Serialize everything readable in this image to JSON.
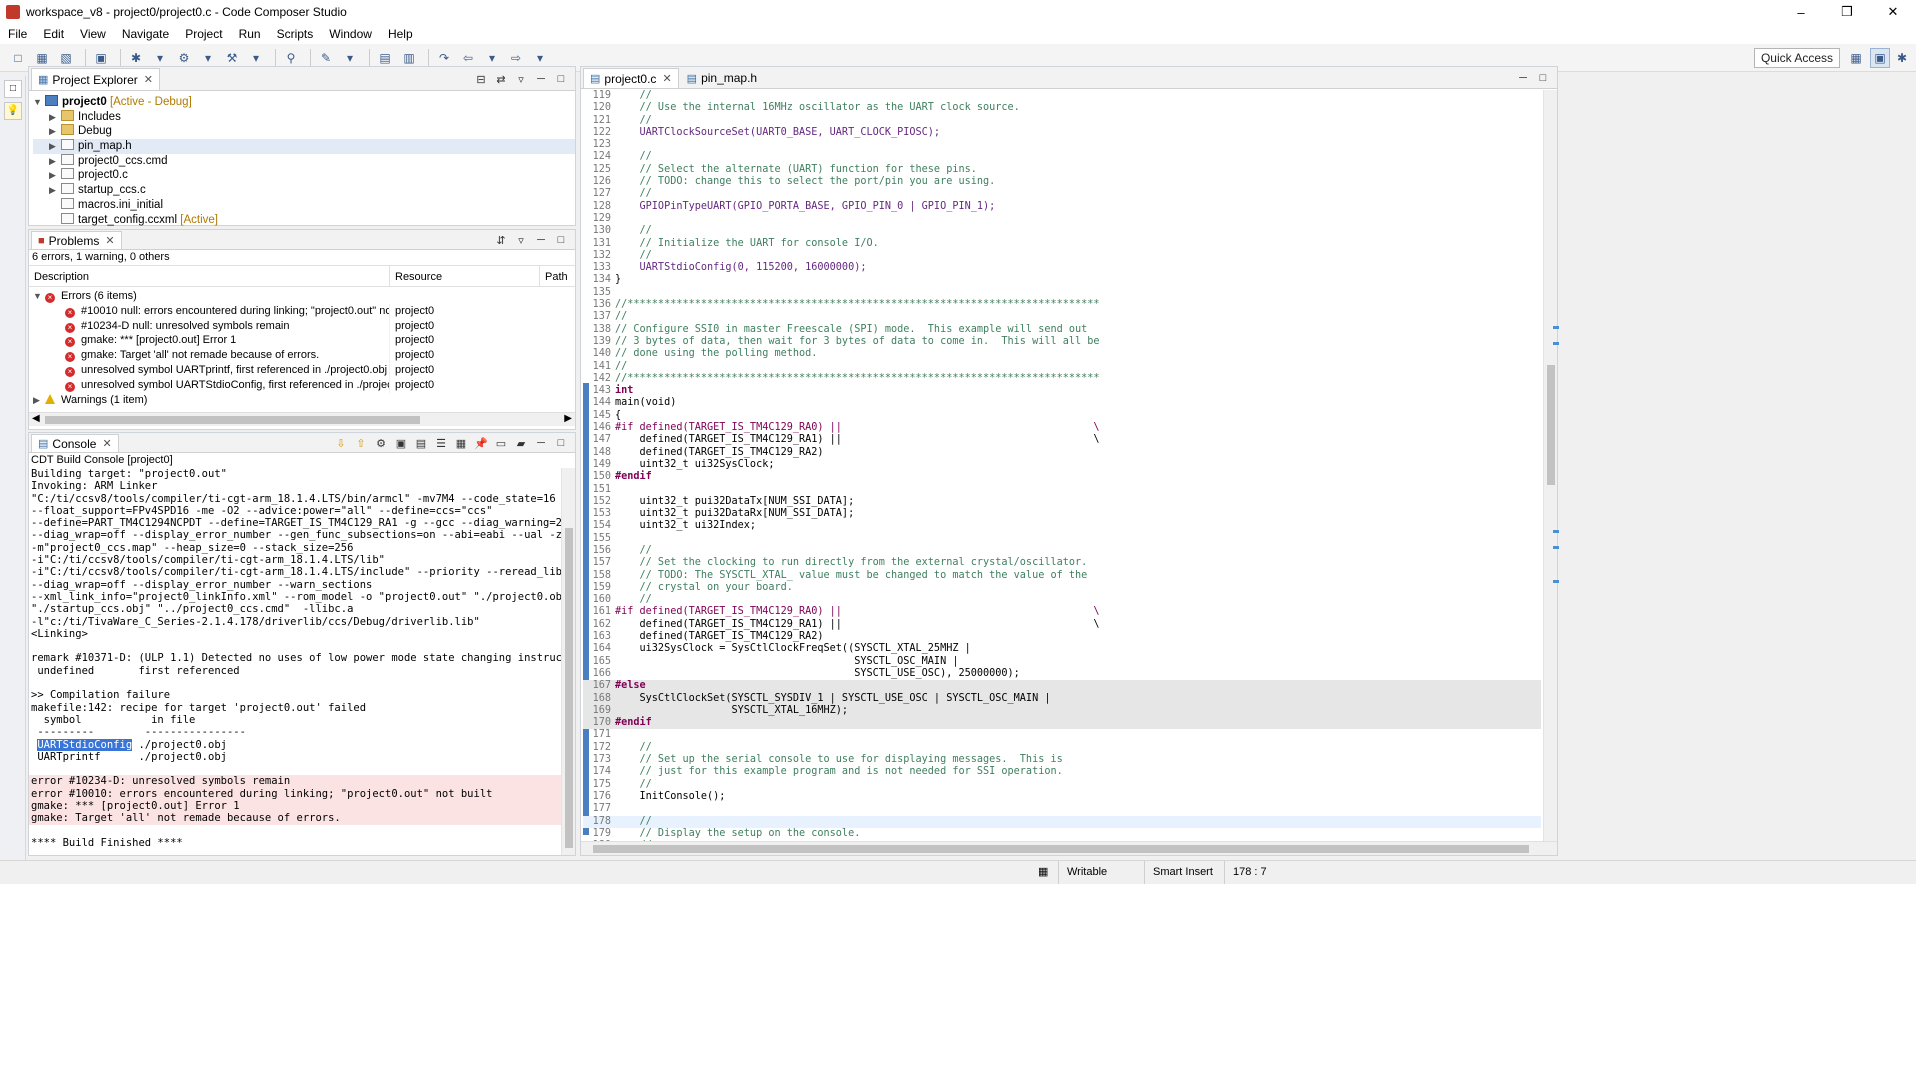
{
  "window": {
    "title": "workspace_v8 - project0/project0.c - Code Composer Studio",
    "controls": [
      "–",
      "❒",
      "✕"
    ]
  },
  "menu": [
    "File",
    "Edit",
    "View",
    "Navigate",
    "Project",
    "Run",
    "Scripts",
    "Window",
    "Help"
  ],
  "toolbar": {
    "quick_access": "Quick Access"
  },
  "project_explorer": {
    "tab_label": "Project Explorer",
    "items": [
      {
        "label": "project0",
        "tag": "[Active - Debug]",
        "icon": "project-icon",
        "indent": 0,
        "expanded": true
      },
      {
        "label": "Includes",
        "tag": "",
        "icon": "includes-icon",
        "indent": 1
      },
      {
        "label": "Debug",
        "tag": "",
        "icon": "folder-icon",
        "indent": 1
      },
      {
        "label": "pin_map.h",
        "tag": "",
        "icon": "header-file-icon",
        "indent": 1,
        "selected": true
      },
      {
        "label": "project0_ccs.cmd",
        "tag": "",
        "icon": "cmd-file-icon",
        "indent": 1
      },
      {
        "label": "project0.c",
        "tag": "",
        "icon": "c-file-icon",
        "indent": 1
      },
      {
        "label": "startup_ccs.c",
        "tag": "",
        "icon": "c-file-icon",
        "indent": 1
      },
      {
        "label": "macros.ini_initial",
        "tag": "",
        "icon": "file-icon",
        "indent": 1,
        "noarrow": true
      },
      {
        "label": "target_config.ccxml",
        "tag": "[Active]",
        "icon": "xml-file-icon",
        "indent": 1,
        "noarrow": true
      }
    ]
  },
  "problems": {
    "tab_label": "Problems",
    "summary": "6 errors, 1 warning, 0 others",
    "columns": [
      "Description",
      "Resource",
      "Path"
    ],
    "errors_group": "Errors (6 items)",
    "errors": [
      {
        "desc": "#10010 null: errors encountered during linking; \"project0.out\" not built",
        "resource": "project0"
      },
      {
        "desc": "#10234-D null: unresolved symbols remain",
        "resource": "project0"
      },
      {
        "desc": "gmake: *** [project0.out] Error 1",
        "resource": "project0"
      },
      {
        "desc": "gmake: Target 'all' not remade because of errors.",
        "resource": "project0"
      },
      {
        "desc": "unresolved symbol UARTprintf, first referenced in ./project0.obj",
        "resource": "project0"
      },
      {
        "desc": "unresolved symbol UARTStdioConfig, first referenced in ./project0.obj",
        "resource": "project0"
      }
    ],
    "warnings_group": "Warnings (1 item)"
  },
  "console": {
    "tab_label": "Console",
    "title": "CDT Build Console [project0]",
    "lines": [
      {
        "t": "Building target: \"project0.out\""
      },
      {
        "t": "Invoking: ARM Linker"
      },
      {
        "t": "\"C:/ti/ccsv8/tools/compiler/ti-cgt-arm_18.1.4.LTS/bin/armcl\" -mv7M4 --code_state=16"
      },
      {
        "t": "--float_support=FPv4SPD16 -me -O2 --advice:power=\"all\" --define=ccs=\"ccs\""
      },
      {
        "t": "--define=PART_TM4C1294NCPDT --define=TARGET_IS_TM4C129_RA1 -g --gcc --diag_warning=225"
      },
      {
        "t": "--diag_wrap=off --display_error_number --gen_func_subsections=on --abi=eabi --ual -z"
      },
      {
        "t": "-m\"project0_ccs.map\" --heap_size=0 --stack_size=256"
      },
      {
        "t": "-i\"C:/ti/ccsv8/tools/compiler/ti-cgt-arm_18.1.4.LTS/lib\""
      },
      {
        "t": "-i\"C:/ti/ccsv8/tools/compiler/ti-cgt-arm_18.1.4.LTS/include\" --priority --reread_libs"
      },
      {
        "t": "--diag_wrap=off --display_error_number --warn_sections"
      },
      {
        "t": "--xml_link_info=\"project0_linkInfo.xml\" --rom_model -o \"project0.out\" \"./project0.obj\""
      },
      {
        "t": "\"./startup_ccs.obj\" \"../project0_ccs.cmd\"  -llibc.a"
      },
      {
        "t": "-l\"c:/ti/TivaWare_C_Series-2.1.4.178/driverlib/ccs/Debug/driverlib.lib\""
      },
      {
        "t": "<Linking>"
      },
      {
        "t": ""
      },
      {
        "t": "remark #10371-D: (ULP 1.1) Detected no uses of low power mode state changing instructions"
      },
      {
        "t": " undefined       first referenced"
      },
      {
        "t": ""
      },
      {
        "t": ">> Compilation failure"
      },
      {
        "t": "makefile:142: recipe for target 'project0.out' failed"
      },
      {
        "t": "  symbol           in file"
      },
      {
        "t": " ---------        ----------------"
      },
      {
        "t": " ./project0.obj",
        "sel": "UARTStdioConfig"
      },
      {
        "t": " UARTprintf      ./project0.obj"
      },
      {
        "t": ""
      },
      {
        "t": "error #10234-D: unresolved symbols remain",
        "err": true
      },
      {
        "t": "error #10010: errors encountered during linking; \"project0.out\" not built",
        "err": true
      },
      {
        "t": "gmake: *** [project0.out] Error 1",
        "err": true
      },
      {
        "t": "gmake: Target 'all' not remade because of errors.",
        "err": true
      },
      {
        "t": ""
      },
      {
        "t": "**** Build Finished ****"
      }
    ]
  },
  "editor": {
    "tabs": [
      {
        "label": "project0.c",
        "active": true
      },
      {
        "label": "pin_map.h",
        "active": false
      }
    ],
    "lines": [
      {
        "n": "119",
        "t": "    //",
        "k": "cm"
      },
      {
        "n": "120",
        "t": "    // Use the internal 16MHz oscillator as the UART clock source.",
        "k": "cm"
      },
      {
        "n": "121",
        "t": "    //",
        "k": "cm"
      },
      {
        "n": "122",
        "t": "    UARTClockSourceSet(UART0_BASE, UART_CLOCK_PIOSC);",
        "k": "fn"
      },
      {
        "n": "123",
        "t": "",
        "k": "nm"
      },
      {
        "n": "124",
        "t": "    //",
        "k": "cm"
      },
      {
        "n": "125",
        "t": "    // Select the alternate (UART) function for these pins.",
        "k": "cm"
      },
      {
        "n": "126",
        "t": "    // TODO: change this to select the port/pin you are using.",
        "k": "cm"
      },
      {
        "n": "127",
        "t": "    //",
        "k": "cm"
      },
      {
        "n": "128",
        "t": "    GPIOPinTypeUART(GPIO_PORTA_BASE, GPIO_PIN_0 | GPIO_PIN_1);",
        "k": "fn"
      },
      {
        "n": "129",
        "t": "",
        "k": "nm"
      },
      {
        "n": "130",
        "t": "    //",
        "k": "cm"
      },
      {
        "n": "131",
        "t": "    // Initialize the UART for console I/O.",
        "k": "cm"
      },
      {
        "n": "132",
        "t": "    //",
        "k": "cm"
      },
      {
        "n": "133",
        "t": "    UARTStdioConfig(0, 115200, 16000000);",
        "k": "fn"
      },
      {
        "n": "134",
        "t": "}",
        "k": "nm"
      },
      {
        "n": "135",
        "t": "",
        "k": "nm"
      },
      {
        "n": "136",
        "t": "//*****************************************************************************",
        "k": "cm"
      },
      {
        "n": "137",
        "t": "//",
        "k": "cm"
      },
      {
        "n": "138",
        "t": "// Configure SSI0 in master Freescale (SPI) mode.  This example will send out",
        "k": "cm"
      },
      {
        "n": "139",
        "t": "// 3 bytes of data, then wait for 3 bytes of data to come in.  This will all be",
        "k": "cm"
      },
      {
        "n": "140",
        "t": "// done using the polling method.",
        "k": "cm"
      },
      {
        "n": "141",
        "t": "//",
        "k": "cm"
      },
      {
        "n": "142",
        "t": "//*****************************************************************************",
        "k": "cm"
      },
      {
        "n": "143",
        "t": "int",
        "k": "kw"
      },
      {
        "n": "144",
        "t": "main(void)",
        "k": "nm"
      },
      {
        "n": "145",
        "t": "{",
        "k": "nm"
      },
      {
        "n": "146",
        "t": "#if defined(TARGET_IS_TM4C129_RA0) ||                                         \\",
        "k": "pp"
      },
      {
        "n": "147",
        "t": "    defined(TARGET_IS_TM4C129_RA1) ||                                         \\",
        "k": "nm"
      },
      {
        "n": "148",
        "t": "    defined(TARGET_IS_TM4C129_RA2)",
        "k": "nm"
      },
      {
        "n": "149",
        "t": "    uint32_t ui32SysClock;",
        "k": "nm"
      },
      {
        "n": "150",
        "t": "#endif",
        "k": "kw"
      },
      {
        "n": "151",
        "t": "",
        "k": "nm"
      },
      {
        "n": "152",
        "t": "    uint32_t pui32DataTx[NUM_SSI_DATA];",
        "k": "nm"
      },
      {
        "n": "153",
        "t": "    uint32_t pui32DataRx[NUM_SSI_DATA];",
        "k": "nm"
      },
      {
        "n": "154",
        "t": "    uint32_t ui32Index;",
        "k": "nm"
      },
      {
        "n": "155",
        "t": "",
        "k": "nm"
      },
      {
        "n": "156",
        "t": "    //",
        "k": "cm"
      },
      {
        "n": "157",
        "t": "    // Set the clocking to run directly from the external crystal/oscillator.",
        "k": "cm"
      },
      {
        "n": "158",
        "t": "    // TODO: The SYSCTL_XTAL_ value must be changed to match the value of the",
        "k": "cm"
      },
      {
        "n": "159",
        "t": "    // crystal on your board.",
        "k": "cm"
      },
      {
        "n": "160",
        "t": "    //",
        "k": "cm"
      },
      {
        "n": "161",
        "t": "#if defined(TARGET_IS_TM4C129_RA0) ||                                         \\",
        "k": "pp"
      },
      {
        "n": "162",
        "t": "    defined(TARGET_IS_TM4C129_RA1) ||                                         \\",
        "k": "nm"
      },
      {
        "n": "163",
        "t": "    defined(TARGET_IS_TM4C129_RA2)",
        "k": "nm"
      },
      {
        "n": "164",
        "t": "    ui32SysClock = SysCtlClockFreqSet((SYSCTL_XTAL_25MHZ |",
        "k": "nm"
      },
      {
        "n": "165",
        "t": "                                       SYSCTL_OSC_MAIN |",
        "k": "nm"
      },
      {
        "n": "166",
        "t": "                                       SYSCTL_USE_OSC), 25000000);",
        "k": "nm"
      },
      {
        "n": "167",
        "t": "#else",
        "k": "kw",
        "dis": true
      },
      {
        "n": "168",
        "t": "    SysCtlClockSet(SYSCTL_SYSDIV_1 | SYSCTL_USE_OSC | SYSCTL_OSC_MAIN |",
        "k": "nm",
        "dis": true
      },
      {
        "n": "169",
        "t": "                   SYSCTL_XTAL_16MHZ);",
        "k": "nm",
        "dis": true
      },
      {
        "n": "170",
        "t": "#endif",
        "k": "kw",
        "dis": true
      },
      {
        "n": "171",
        "t": "",
        "k": "nm"
      },
      {
        "n": "172",
        "t": "    //",
        "k": "cm"
      },
      {
        "n": "173",
        "t": "    // Set up the serial console to use for displaying messages.  This is",
        "k": "cm"
      },
      {
        "n": "174",
        "t": "    // just for this example program and is not needed for SSI operation.",
        "k": "cm"
      },
      {
        "n": "175",
        "t": "    //",
        "k": "cm"
      },
      {
        "n": "176",
        "t": "    InitConsole();",
        "k": "nm"
      },
      {
        "n": "177",
        "t": "",
        "k": "nm"
      },
      {
        "n": "178",
        "t": "    //",
        "k": "cm",
        "cur": true
      },
      {
        "n": "179",
        "t": "    // Display the setup on the console.",
        "k": "cm"
      },
      {
        "n": "180",
        "t": "    //",
        "k": "cm"
      }
    ]
  },
  "status": {
    "mode1": "Writable",
    "mode2": "Smart Insert",
    "position": "178 : 7"
  }
}
